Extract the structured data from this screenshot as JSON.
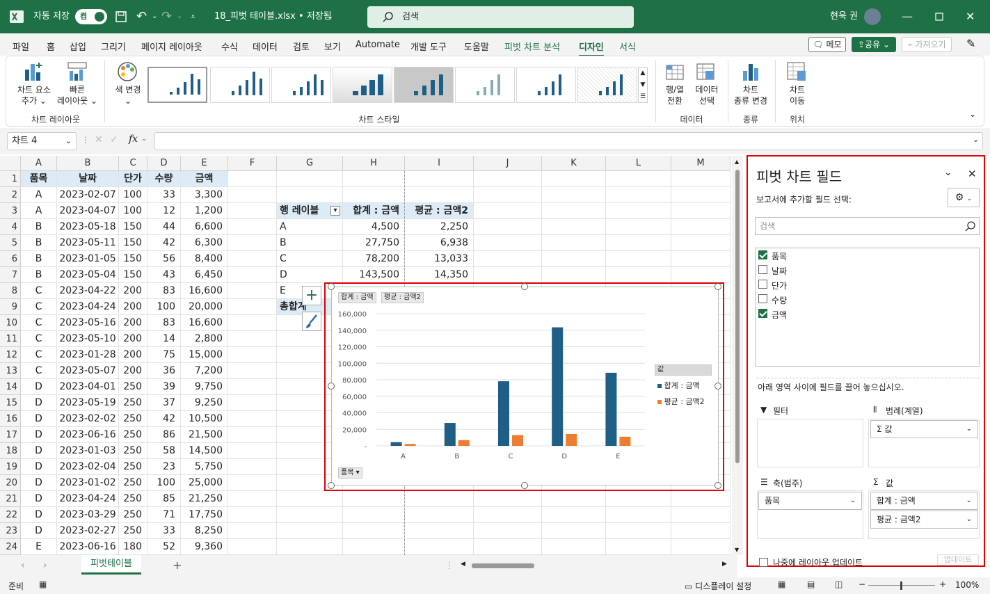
{
  "titlebar": {
    "autosave_label": "자동 저장",
    "autosave_state": "켬",
    "filename": "18_피벗 테이블.xlsx • 저장됨",
    "search_placeholder": "검색",
    "user_name": "현욱 권"
  },
  "menu": {
    "items": [
      "파일",
      "홈",
      "삽입",
      "그리기",
      "페이지 레이아웃",
      "수식",
      "데이터",
      "검토",
      "보기",
      "Automate",
      "개발 도구",
      "도움말",
      "피벗 차트 분석",
      "디자인",
      "서식"
    ],
    "memo": "메모",
    "share": "공유",
    "get_addins": "가져오기"
  },
  "ribbon": {
    "add_chart_element": [
      "차트 요소",
      "추가"
    ],
    "quick_layout": [
      "빠른",
      "레이아웃"
    ],
    "group_layout": "차트 레이아웃",
    "change_colors": "색 변경",
    "group_styles": "차트 스타일",
    "switch_row_col": [
      "행/열",
      "전환"
    ],
    "select_data": [
      "데이터",
      "선택"
    ],
    "group_data": "데이터",
    "change_type": [
      "차트",
      "종류 변경"
    ],
    "group_type": "종류",
    "move_chart": [
      "차트",
      "이동"
    ],
    "group_location": "위치"
  },
  "formula": {
    "name_box": "차트 4",
    "fx": "fx"
  },
  "columns": [
    "A",
    "B",
    "C",
    "D",
    "E",
    "F",
    "G",
    "H",
    "I",
    "J",
    "K",
    "L",
    "M"
  ],
  "rows": [
    "1",
    "2",
    "3",
    "4",
    "5",
    "6",
    "7",
    "8",
    "9",
    "10",
    "11",
    "12",
    "13",
    "14",
    "15",
    "16",
    "17",
    "18",
    "19",
    "20",
    "21",
    "22",
    "23",
    "24"
  ],
  "table": {
    "headers": [
      "품목",
      "날짜",
      "단가",
      "수량",
      "금액"
    ],
    "data": [
      [
        "A",
        "2023-02-07",
        "100",
        "33",
        "3,300"
      ],
      [
        "A",
        "2023-04-07",
        "100",
        "12",
        "1,200"
      ],
      [
        "B",
        "2023-05-18",
        "150",
        "44",
        "6,600"
      ],
      [
        "B",
        "2023-05-11",
        "150",
        "42",
        "6,300"
      ],
      [
        "B",
        "2023-01-05",
        "150",
        "56",
        "8,400"
      ],
      [
        "B",
        "2023-05-04",
        "150",
        "43",
        "6,450"
      ],
      [
        "C",
        "2023-04-22",
        "200",
        "83",
        "16,600"
      ],
      [
        "C",
        "2023-04-24",
        "200",
        "100",
        "20,000"
      ],
      [
        "C",
        "2023-05-16",
        "200",
        "83",
        "16,600"
      ],
      [
        "C",
        "2023-05-10",
        "200",
        "14",
        "2,800"
      ],
      [
        "C",
        "2023-01-28",
        "200",
        "75",
        "15,000"
      ],
      [
        "C",
        "2023-05-07",
        "200",
        "36",
        "7,200"
      ],
      [
        "D",
        "2023-04-01",
        "250",
        "39",
        "9,750"
      ],
      [
        "D",
        "2023-05-19",
        "250",
        "37",
        "9,250"
      ],
      [
        "D",
        "2023-02-02",
        "250",
        "42",
        "10,500"
      ],
      [
        "D",
        "2023-06-16",
        "250",
        "86",
        "21,500"
      ],
      [
        "D",
        "2023-01-03",
        "250",
        "58",
        "14,500"
      ],
      [
        "D",
        "2023-02-04",
        "250",
        "23",
        "5,750"
      ],
      [
        "D",
        "2023-01-02",
        "250",
        "100",
        "25,000"
      ],
      [
        "D",
        "2023-04-24",
        "250",
        "85",
        "21,250"
      ],
      [
        "D",
        "2023-03-29",
        "250",
        "71",
        "17,750"
      ],
      [
        "D",
        "2023-02-27",
        "250",
        "33",
        "8,250"
      ],
      [
        "E",
        "2023-06-16",
        "180",
        "52",
        "9,360"
      ]
    ]
  },
  "pivot": {
    "headers": [
      "행 레이블",
      "합계 : 금액",
      "평균 : 금액2"
    ],
    "rows": [
      [
        "A",
        "4,500",
        "2,250"
      ],
      [
        "B",
        "27,750",
        "6,938"
      ],
      [
        "C",
        "78,200",
        "13,033"
      ],
      [
        "D",
        "143,500",
        "14,350"
      ],
      [
        "E",
        "",
        ""
      ]
    ],
    "total_label": "총합계"
  },
  "chart_data": {
    "type": "bar",
    "categories": [
      "A",
      "B",
      "C",
      "D",
      "E"
    ],
    "series": [
      {
        "name": "합계 : 금액",
        "values": [
          4500,
          27750,
          78200,
          143500,
          88500
        ]
      },
      {
        "name": "평균 : 금액2",
        "values": [
          2250,
          6938,
          13033,
          14350,
          11063
        ]
      }
    ],
    "ylim": [
      0,
      160000
    ],
    "yticks": [
      "160,000",
      "140,000",
      "120,000",
      "100,000",
      "80,000",
      "60,000",
      "40,000",
      "20,000",
      "-"
    ],
    "legend_title": "값",
    "field_buttons": [
      "합계 : 금액",
      "평균 : 금액2"
    ],
    "axis_field_button": "품목",
    "colors": [
      "#1f5f86",
      "#ed7d31"
    ],
    "legend": "right"
  },
  "pane": {
    "title": "피벗 차트 필드",
    "subtitle": "보고서에 추가할 필드 선택:",
    "search_placeholder": "검색",
    "fields": [
      {
        "label": "품목",
        "checked": true
      },
      {
        "label": "날짜",
        "checked": false
      },
      {
        "label": "단가",
        "checked": false
      },
      {
        "label": "수량",
        "checked": false
      },
      {
        "label": "금액",
        "checked": true
      }
    ],
    "drag_hint": "아래 영역 사이에 필드를 끌어 놓으십시오.",
    "area_filter": "필터",
    "area_legend": "범례(계열)",
    "area_axis": "축(범주)",
    "area_values": "값",
    "legend_item": "Σ 값",
    "axis_item": "품목",
    "value_items": [
      "합계 : 금액",
      "평균 : 금액2"
    ],
    "defer_label": "나중에 레이아웃 업데이트",
    "update_button": "업데이트"
  },
  "sheet_tab": "피벗테이블",
  "status": {
    "ready": "준비",
    "display_settings": "디스플레이 설정",
    "zoom": "100%"
  }
}
